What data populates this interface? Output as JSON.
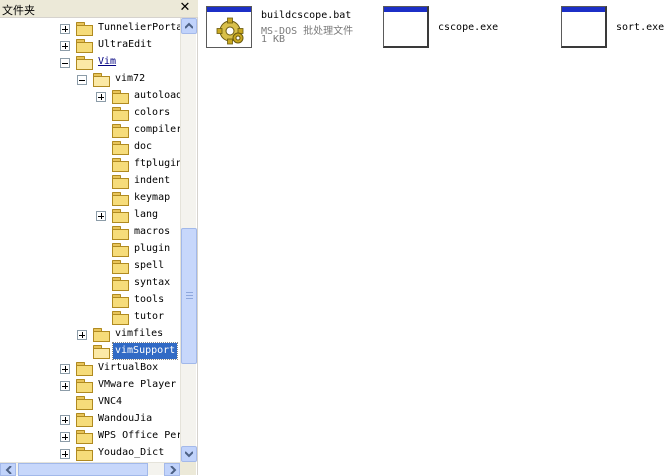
{
  "pane": {
    "title": "文件夹",
    "close_glyph": "✕"
  },
  "tree": [
    {
      "label": "TunnelierPorta",
      "depth": 3,
      "toggle": "plus",
      "open": false
    },
    {
      "label": "UltraEdit",
      "depth": 3,
      "toggle": "plus",
      "open": false
    },
    {
      "label": "Vim",
      "depth": 3,
      "toggle": "minus",
      "open": true,
      "underline": true
    },
    {
      "label": "vim72",
      "depth": 4,
      "toggle": "minus",
      "open": true
    },
    {
      "label": "autoload",
      "depth": 5,
      "toggle": "plus",
      "open": false
    },
    {
      "label": "colors",
      "depth": 5,
      "toggle": null,
      "open": false
    },
    {
      "label": "compiler",
      "depth": 5,
      "toggle": null,
      "open": false
    },
    {
      "label": "doc",
      "depth": 5,
      "toggle": null,
      "open": false
    },
    {
      "label": "ftplugin",
      "depth": 5,
      "toggle": null,
      "open": false
    },
    {
      "label": "indent",
      "depth": 5,
      "toggle": null,
      "open": false
    },
    {
      "label": "keymap",
      "depth": 5,
      "toggle": null,
      "open": false
    },
    {
      "label": "lang",
      "depth": 5,
      "toggle": "plus",
      "open": false
    },
    {
      "label": "macros",
      "depth": 5,
      "toggle": null,
      "open": false
    },
    {
      "label": "plugin",
      "depth": 5,
      "toggle": null,
      "open": false
    },
    {
      "label": "spell",
      "depth": 5,
      "toggle": null,
      "open": false
    },
    {
      "label": "syntax",
      "depth": 5,
      "toggle": null,
      "open": false
    },
    {
      "label": "tools",
      "depth": 5,
      "toggle": null,
      "open": false
    },
    {
      "label": "tutor",
      "depth": 5,
      "toggle": null,
      "open": false
    },
    {
      "label": "vimfiles",
      "depth": 4,
      "toggle": "plus",
      "open": false
    },
    {
      "label": "vimSupport",
      "depth": 4,
      "toggle": null,
      "open": true,
      "selected": true
    },
    {
      "label": "VirtualBox",
      "depth": 3,
      "toggle": "plus",
      "open": false
    },
    {
      "label": "VMware Player",
      "depth": 3,
      "toggle": "plus",
      "open": false
    },
    {
      "label": "VNC4",
      "depth": 3,
      "toggle": null,
      "open": false
    },
    {
      "label": "WandouJia",
      "depth": 3,
      "toggle": "plus",
      "open": false
    },
    {
      "label": "WPS Office Per",
      "depth": 3,
      "toggle": "plus",
      "open": false
    },
    {
      "label": "Youdao_Dict",
      "depth": 3,
      "toggle": "plus",
      "open": false
    }
  ],
  "files": [
    {
      "name": "buildcscope.bat",
      "type": "MS-DOS 批处理文件",
      "size": "1 KB",
      "icon": "batch-gear-icon"
    },
    {
      "name": "cscope.exe",
      "type": "",
      "size": "",
      "icon": "application-window-icon"
    },
    {
      "name": "sort.exe",
      "type": "",
      "size": "",
      "icon": "application-window-icon"
    }
  ],
  "colors": {
    "selection": "#316ac5",
    "titlebar": "#1c2fc7",
    "scrollbar": "#c1d3fb"
  }
}
